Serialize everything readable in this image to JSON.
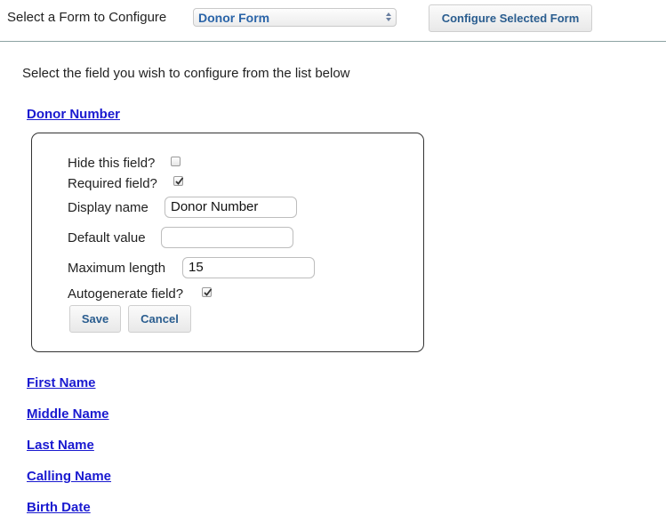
{
  "header": {
    "select_form_label": "Select a Form to Configure",
    "selected_form": "Donor Form",
    "configure_button": "Configure Selected Form"
  },
  "instructions": "Select the field you wish to configure from the list below",
  "active_field": {
    "name": "Donor Number",
    "hide_label": "Hide this field?",
    "hide_checked": false,
    "required_label": "Required field?",
    "required_checked": true,
    "display_name_label": "Display name",
    "display_name_value": "Donor Number",
    "default_value_label": "Default value",
    "default_value_value": "",
    "max_length_label": "Maximum length",
    "max_length_value": "15",
    "autogenerate_label": "Autogenerate field?",
    "autogenerate_checked": true,
    "save_button": "Save",
    "cancel_button": "Cancel"
  },
  "fields": [
    {
      "label": "First Name"
    },
    {
      "label": "Middle Name"
    },
    {
      "label": "Last Name"
    },
    {
      "label": "Calling Name"
    },
    {
      "label": "Birth Date"
    }
  ],
  "colors": {
    "link": "#1a1ad0",
    "select_text": "#2a64a8",
    "button_text": "#2a5d8f"
  }
}
